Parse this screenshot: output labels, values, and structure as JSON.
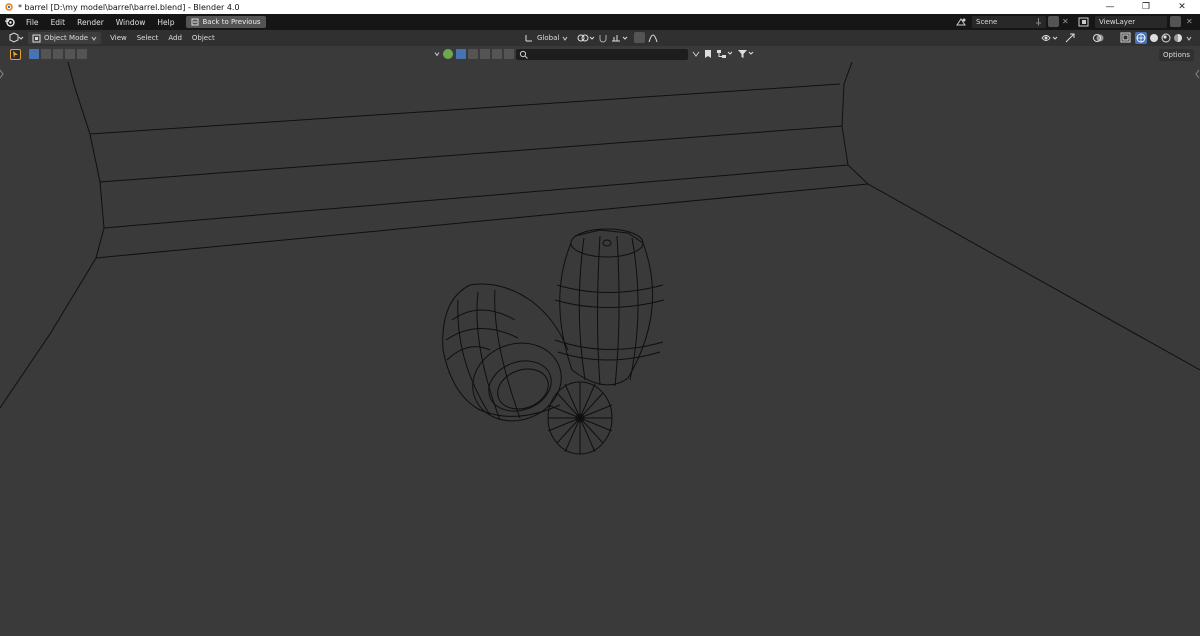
{
  "window": {
    "title": "* barrel [D:\\my model\\barrel\\barrel.blend] - Blender 4.0",
    "minimize_glyph": "—",
    "maximize_glyph": "❐",
    "close_glyph": "✕"
  },
  "menubar": {
    "items": [
      "File",
      "Edit",
      "Render",
      "Window",
      "Help"
    ],
    "back_label": "Back to Previous",
    "scene_label": "Scene",
    "viewlayer_label": "ViewLayer"
  },
  "viewport_header": {
    "mode_label": "Object Mode",
    "menus": [
      "View",
      "Select",
      "Add",
      "Object"
    ],
    "orientation_label": "Global",
    "options_label": "Options"
  },
  "colors": {
    "accent": "#4772b3",
    "viewport_bg": "#3a3a3a",
    "wire": "#0f0f0f"
  }
}
